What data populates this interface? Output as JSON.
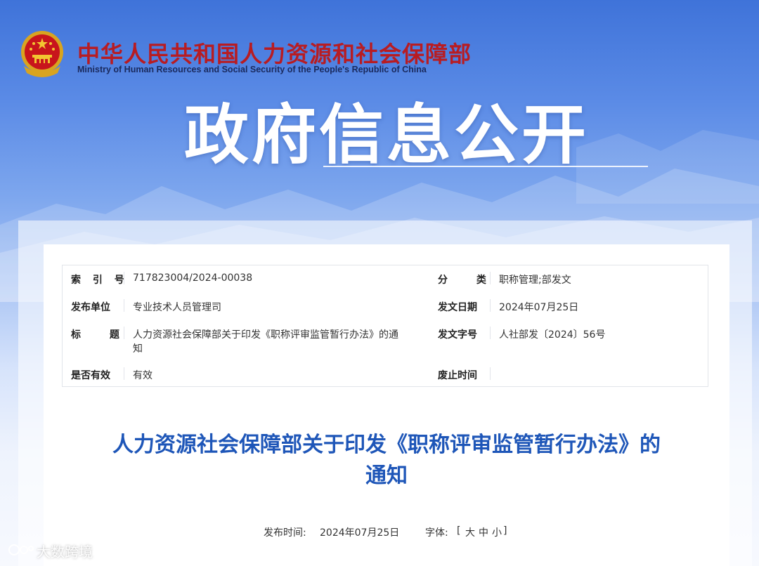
{
  "header": {
    "ministry_cn": "中华人民共和国人力资源和社会保障部",
    "ministry_en": "Ministry of Human Resources and Social Security of the People's Republic of China",
    "banner_title": "政府信息公开"
  },
  "meta": {
    "index_label": "索 引 号",
    "index_value": "717823004/2024-00038",
    "category_label": "分 类",
    "category_value": "职称管理;部发文",
    "issuer_label": "发布单位",
    "issuer_value": "专业技术人员管理司",
    "date_label": "发文日期",
    "date_value": "2024年07月25日",
    "title_label": "标 题",
    "title_value_line1": "人力资源社会保障部关于印发《职称评审监管暂行办法》的通",
    "title_value_line2": "知",
    "docno_label": "发文字号",
    "docno_value": "人社部发〔2024〕56号",
    "valid_label": "是否有效",
    "valid_value": "有效",
    "expire_label": "废止时间",
    "expire_value": ""
  },
  "document": {
    "title_line1": "人力资源社会保障部关于印发《职称评审监管暂行办法》的",
    "title_line2": "通知",
    "publish_label": "发布时间:",
    "publish_date": "2024年07月25日",
    "font_label": "字体:",
    "font_open": "[",
    "font_large": "大",
    "font_medium": "中",
    "font_small": "小",
    "font_close": "]"
  },
  "watermark": {
    "text": "大数跨境"
  },
  "colors": {
    "ministry_red": "#b81c22",
    "title_blue": "#1e56b8"
  }
}
